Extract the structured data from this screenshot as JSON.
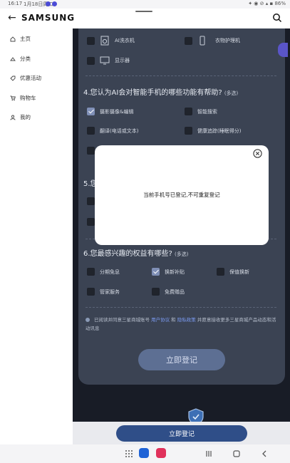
{
  "status_bar": {
    "time": "16:17",
    "date": "1月18日周二",
    "right": "✦ ◉ ⊘ ▴ ▪ 86%"
  },
  "app_bar": {
    "brand": "SAMSUNG"
  },
  "sidebar": {
    "items": [
      {
        "label": "主页",
        "icon": "home-icon"
      },
      {
        "label": "分类",
        "icon": "category-icon"
      },
      {
        "label": "优惠活动",
        "icon": "tag-icon"
      },
      {
        "label": "购物车",
        "icon": "cart-icon"
      },
      {
        "label": "我的",
        "icon": "user-icon"
      }
    ]
  },
  "survey": {
    "q3_options": [
      {
        "label": "AI洗衣机",
        "checked": false,
        "icon": "washer-icon"
      },
      {
        "label": "衣物护理机",
        "checked": false,
        "icon": "phone-device-icon"
      },
      {
        "label": "显示器",
        "checked": false,
        "icon": "monitor-icon"
      }
    ],
    "q4": {
      "title": "4.您认为AI会对智能手机的哪些功能有帮助?",
      "sub": "(多选)",
      "options": [
        {
          "label": "摄影摄像&编辑",
          "checked": true
        },
        {
          "label": "智能搜索",
          "checked": false
        },
        {
          "label": "翻译(电话或文本)",
          "checked": false
        },
        {
          "label": "健康追踪(睡眠得分)",
          "checked": false
        }
      ]
    },
    "q5": {
      "title": "5.您"
    },
    "q6": {
      "title": "6.您最感兴趣的权益有哪些?",
      "sub": "(多选)",
      "options": [
        {
          "label": "分期免息",
          "checked": false
        },
        {
          "label": "换新补贴",
          "checked": true
        },
        {
          "label": "保值换新",
          "checked": false
        },
        {
          "label": "管家服务",
          "checked": false
        },
        {
          "label": "免费赠品",
          "checked": false
        }
      ]
    },
    "consent": {
      "prefix": "已阅读并同意三星商城账号",
      "link1": "用户协议",
      "and": "和",
      "link2": "隐私政策",
      "suffix": "并愿意接收更多三星商城产品动态和活动讯息"
    },
    "submit_label": "立即登记"
  },
  "modal": {
    "message": "当前手机号已登记,不可重复登记"
  },
  "bottom": {
    "submit_label": "立即登记"
  },
  "colors": {
    "accent": "#2f4e88",
    "card": "#3b4353",
    "link": "#7b9bf2"
  }
}
